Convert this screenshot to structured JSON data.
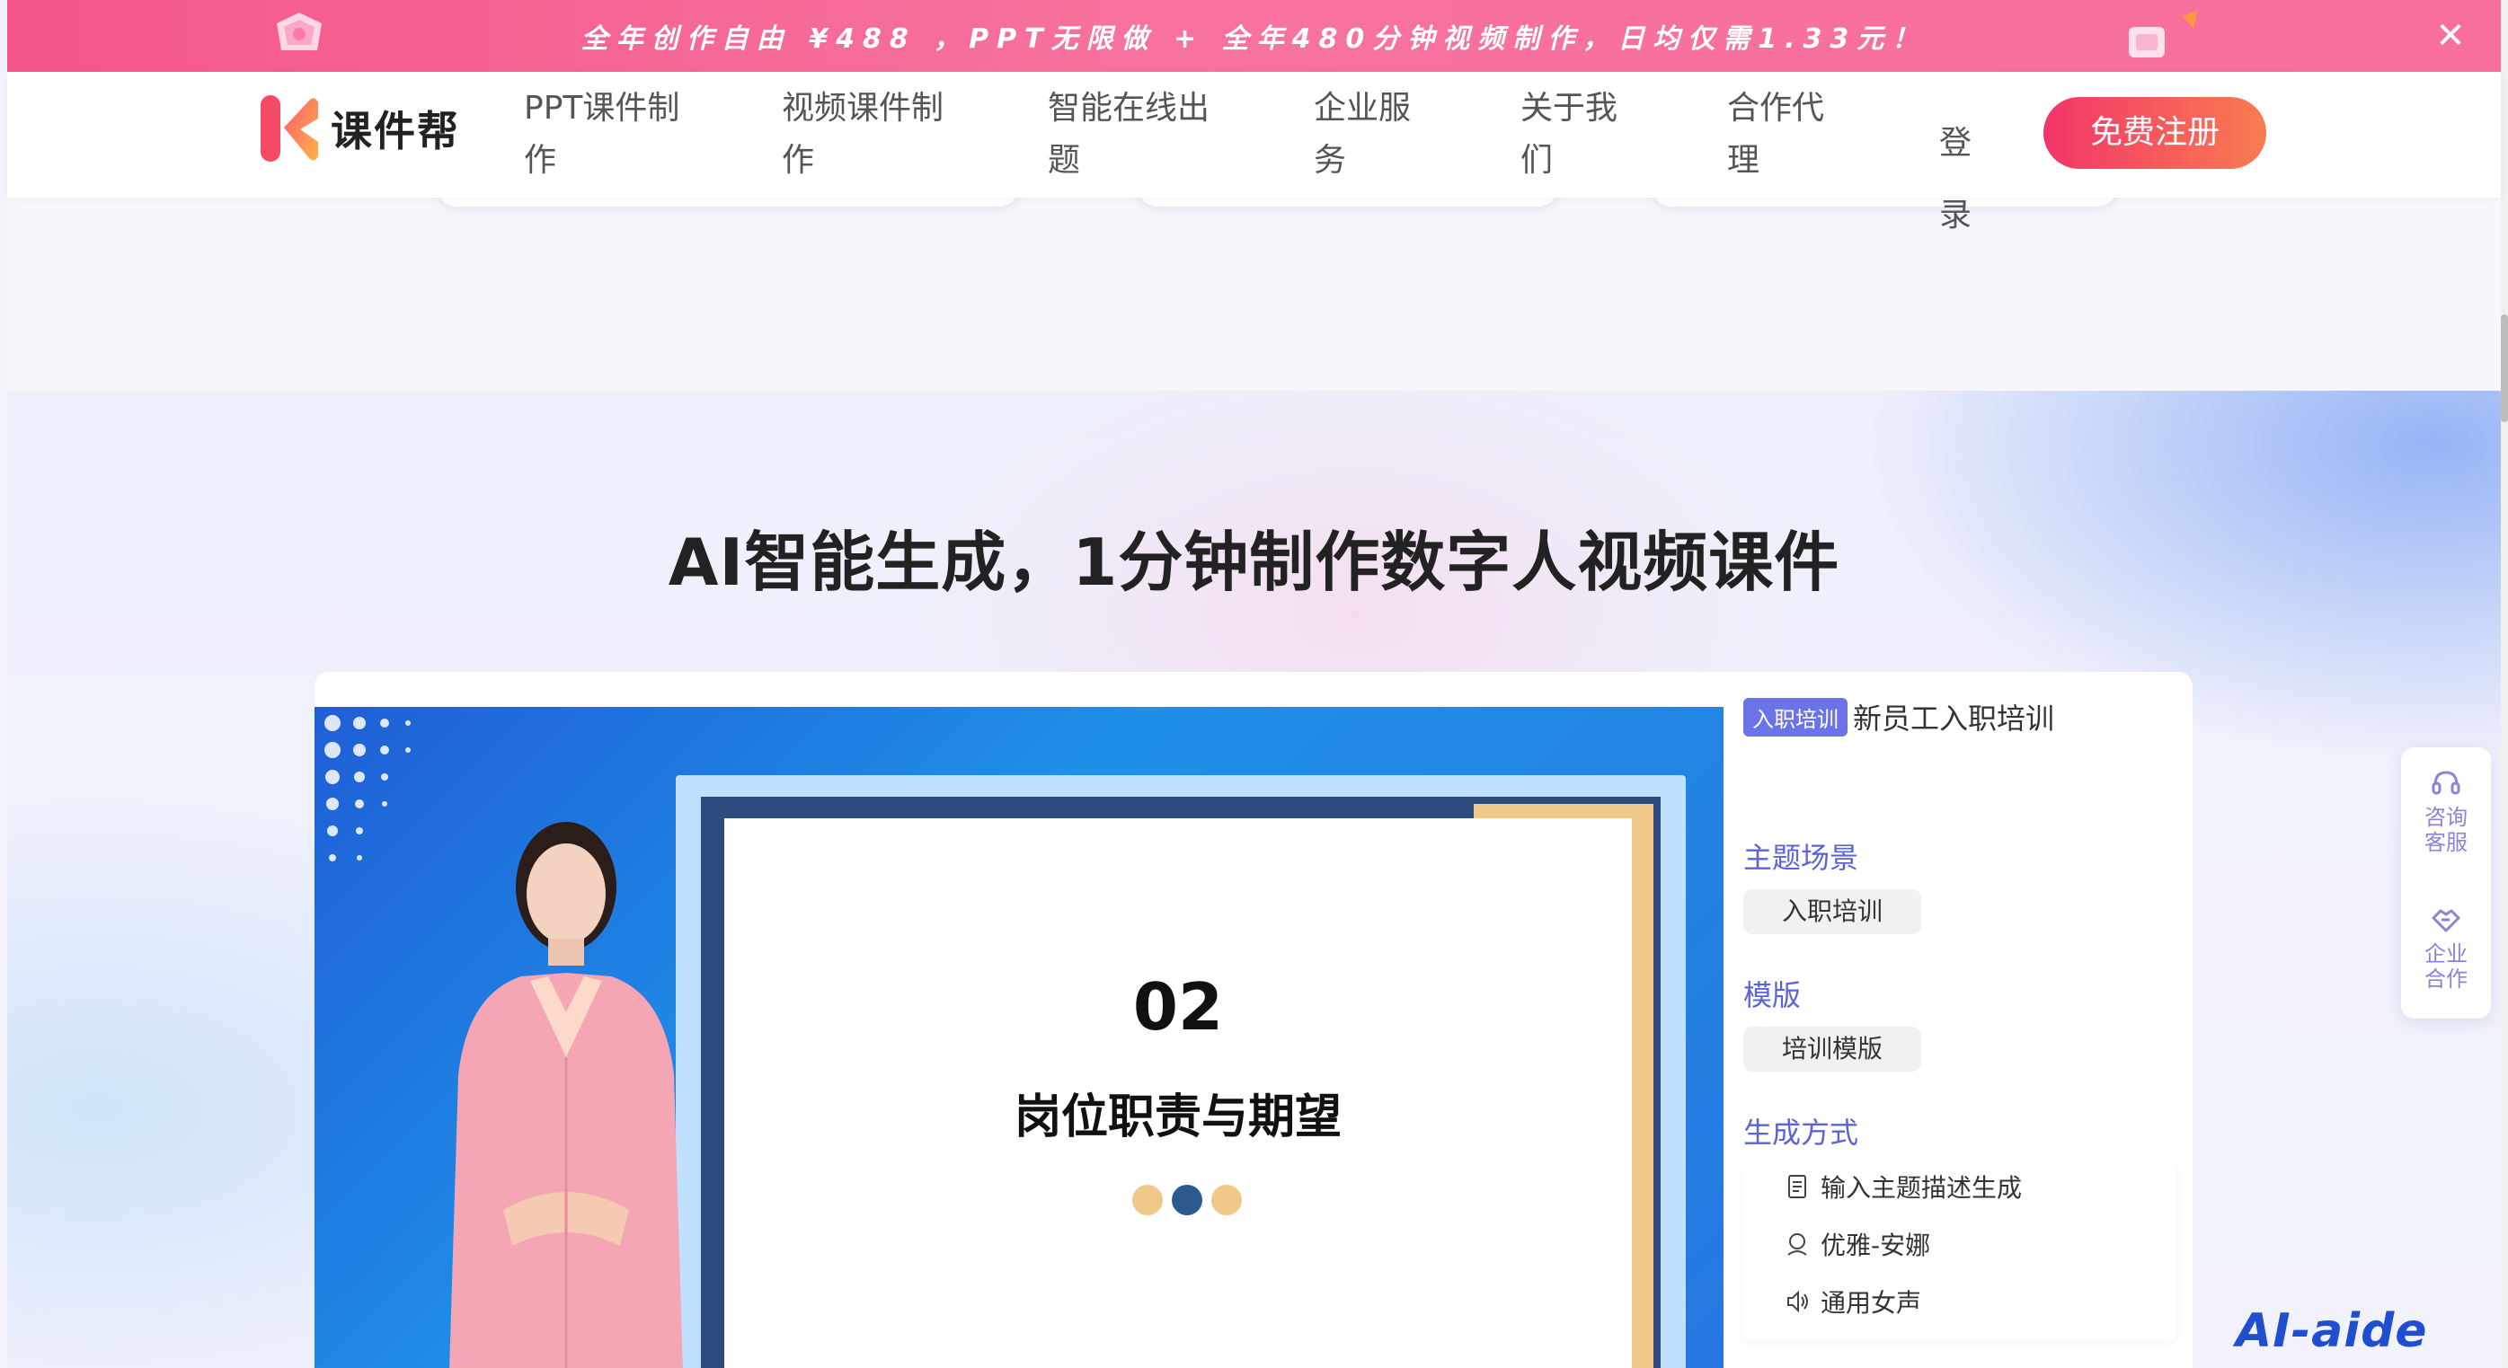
{
  "promo": {
    "text": "全年创作自由 ¥488 ，PPT无限做 + 全年480分钟视频制作，日均仅需1.33元！",
    "close_label": "✕"
  },
  "header": {
    "logo_text": "课件帮",
    "nav": [
      {
        "line1": "PPT课件制",
        "line2": "作"
      },
      {
        "line1": "视频课件制",
        "line2": "作"
      },
      {
        "line1": "智能在线出",
        "line2": "题"
      },
      {
        "line1": "企业服",
        "line2": "务"
      },
      {
        "line1": "关于我",
        "line2": "们"
      },
      {
        "line1": "合作代",
        "line2": "理"
      }
    ],
    "login": {
      "line1": "登",
      "line2": "录"
    },
    "register": "免费注册"
  },
  "section": {
    "title": "AI智能生成，1分钟制作数字人视频课件"
  },
  "demo": {
    "slide_number": "02",
    "slide_title": "岗位职责与期望",
    "tag": "入职培训",
    "title": "新员工入职培训",
    "theme_label": "主题场景",
    "theme_value": "入职培训",
    "template_label": "模版",
    "template_value": "培训模版",
    "method_label": "生成方式",
    "methods": [
      {
        "icon": "document-icon",
        "text": "输入主题描述生成"
      },
      {
        "icon": "voice-avatar-icon",
        "text": "优雅-安娜"
      },
      {
        "icon": "speaker-icon",
        "text": "通用女声"
      }
    ]
  },
  "float_panel": {
    "consult": {
      "line1": "咨询",
      "line2": "客服"
    },
    "enterprise": {
      "line1": "企业",
      "line2": "合作"
    }
  },
  "watermark": "AI-aide",
  "colors": {
    "promo_bg": "#f7729c",
    "register_start": "#f3356a",
    "register_end": "#f97c50",
    "accent_purple": "#5b63d9",
    "tag_bg": "#6b73e8"
  }
}
